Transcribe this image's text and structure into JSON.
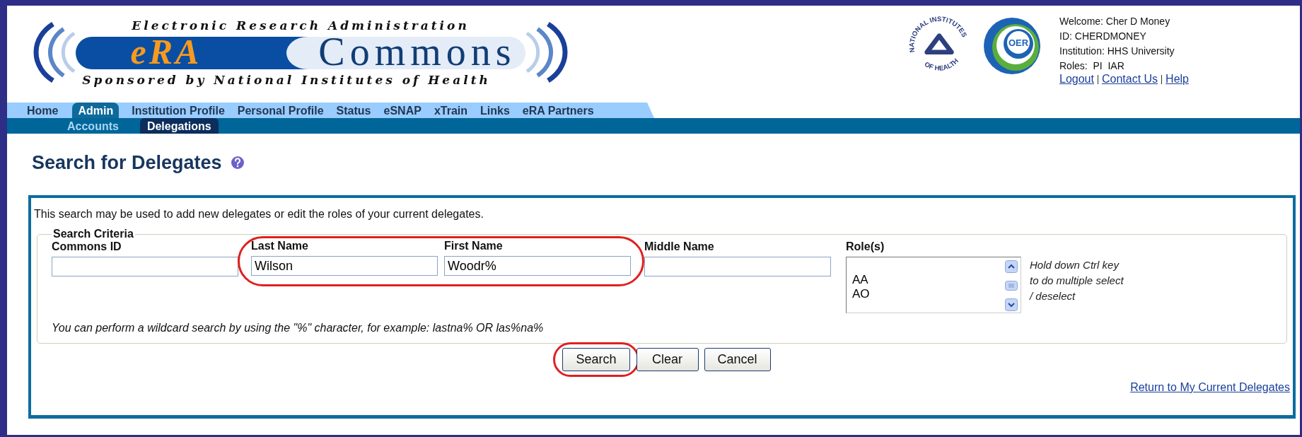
{
  "logo": {
    "top_text": "Electronic Research Administration",
    "left_text": "eRA",
    "right_text": "Commons",
    "bottom_text": "Sponsored by National Institutes of Health"
  },
  "seals": {
    "nih_top": "NATIONAL INSTITUTES",
    "nih_bottom": "OF HEALTH",
    "oer_text": "OER"
  },
  "user_info": [
    "Welcome: Cher D Money",
    "ID: CHERDMONEY",
    "Institution: HHS University",
    "Roles:  PI  IAR"
  ],
  "user_links": [
    "Logout",
    "Contact Us",
    "Help"
  ],
  "tabs": [
    {
      "label": "Home",
      "selected": false
    },
    {
      "label": "Admin",
      "selected": true
    },
    {
      "label": "Institution Profile",
      "selected": false
    },
    {
      "label": "Personal Profile",
      "selected": false
    },
    {
      "label": "Status",
      "selected": false
    },
    {
      "label": "eSNAP",
      "selected": false
    },
    {
      "label": "xTrain",
      "selected": false
    },
    {
      "label": "Links",
      "selected": false
    },
    {
      "label": "eRA Partners",
      "selected": false
    }
  ],
  "subtabs": [
    {
      "label": "Accounts",
      "selected": false
    },
    {
      "label": "Delegations",
      "selected": true
    }
  ],
  "page_title": "Search for Delegates",
  "intro": "This search may be used to add new delegates or edit the roles of your current delegates.",
  "criteria": {
    "legend": "Search Criteria",
    "fields": [
      {
        "label": "Commons ID",
        "circled": false
      },
      {
        "label": "Last Name",
        "value": "Wilson",
        "circled": true
      },
      {
        "label": "First Name",
        "value": "Woodr%",
        "circled": true
      },
      {
        "label": "Middle Name",
        "circled": false
      }
    ],
    "roles": {
      "label": "Role(s)",
      "options": [
        "AA",
        "AO"
      ]
    },
    "roles_hint": "Hold down Ctrl key to do multiple select / deselect",
    "wildcard_hint": "You can perform a wildcard search by using the \"%\" character, for example: lastna% OR las%na%"
  },
  "buttons": [
    {
      "label": "Search",
      "circled": true
    },
    {
      "label": "Clear",
      "circled": false
    },
    {
      "label": "Cancel",
      "circled": false
    }
  ],
  "return_link": "Return to My Current Delegates"
}
